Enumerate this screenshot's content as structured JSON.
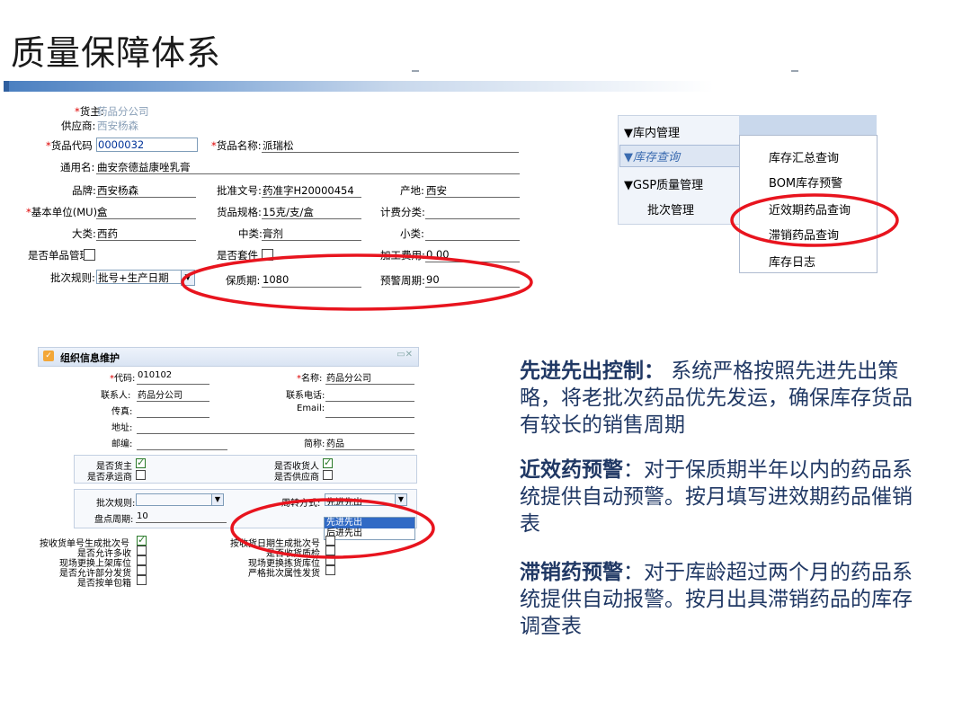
{
  "slide_title": "质量保障体系",
  "form1": {
    "owner_label": "货主:",
    "owner_value": "药品分公司",
    "supplier_label": "供应商:",
    "supplier_value": "西安杨森",
    "code_label": "货品代码",
    "code_value": "0000032",
    "name_label": "货品名称:",
    "name_value": "派瑞松",
    "common_label": "通用名:",
    "common_value": "曲安奈德益康唑乳膏",
    "brand_label": "品牌:",
    "brand_value": "西安杨森",
    "approval_label": "批准文号:",
    "approval_value": "药准字H20000454",
    "origin_label": "产地:",
    "origin_value": "西安",
    "unit_label": "基本单位(MU):",
    "unit_value": "盒",
    "spec_label": "货品规格:",
    "spec_value": "15克/支/盒",
    "billing_label": "计费分类:",
    "billing_value": "",
    "major_label": "大类:",
    "major_value": "西药",
    "mid_label": "中类:",
    "mid_value": "膏剂",
    "minor_label": "小类:",
    "minor_value": "",
    "single_label": "是否单品管理",
    "kit_label": "是否套件",
    "fee_label": "加工费用:",
    "fee_value": "0.00",
    "batch_label": "批次规则:",
    "batch_value": "批号+生产日期",
    "shelf_label": "保质期:",
    "shelf_value": "1080",
    "alert_label": "预警周期:",
    "alert_value": "90"
  },
  "menu": {
    "left_items": [
      "▼库内管理",
      "▼库存查询",
      "▼GSP质量管理",
      "批次管理"
    ],
    "right_items": [
      "库存汇总查询",
      "BOM库存预警",
      "近效期药品查询",
      "滞销药品查询",
      "库存日志"
    ]
  },
  "form2": {
    "title": "组织信息维护",
    "code_label": "代码:",
    "code_value": "010102",
    "name_label": "名称:",
    "name_value": "药品分公司",
    "contact_label": "联系人:",
    "contact_value": "药品分公司",
    "phone_label": "联系电话:",
    "fax_label": "传真:",
    "email_label": "Email:",
    "addr_label": "地址:",
    "zip_label": "邮编:",
    "short_label": "简称:",
    "short_value": "药品",
    "is_owner": "是否货主",
    "is_carrier": "是否承运商",
    "is_receiver": "是否收货人",
    "is_supplier": "是否供应商",
    "batch_rule_label": "批次规则:",
    "turnover_label": "周转方式:",
    "turnover_value": "先进先出",
    "turnover_options": [
      "先进先出",
      "后进先出"
    ],
    "count_label": "盘点周期:",
    "count_value": "10",
    "left_checks": [
      "按收货单号生成批次号",
      "是否允许多收",
      "现场更换上架库位",
      "是否允许部分发货",
      "是否按单包箱"
    ],
    "right_checks": [
      "按收货日期生成批次号",
      "是否收货质检",
      "现场更换拣货库位",
      "严格批次属性发货"
    ]
  },
  "text_blocks": [
    {
      "head": "先进先出控制：",
      "body": " 系统严格按照先进先出策略，将老批次药品优先发运，确保库存货品有较长的销售周期"
    },
    {
      "head": "近效药预警",
      "body": "：对于保质期半年以内的药品系统提供自动预警。按月填写进效期药品催销表"
    },
    {
      "head": "滞销药预警",
      "body": "：对于库龄超过两个月的药品系统提供自动报警。按月出具滞销药品的库存调查表"
    }
  ],
  "colors": {
    "accent_text": "#203864",
    "highlight_ellipse": "#e8141e"
  }
}
